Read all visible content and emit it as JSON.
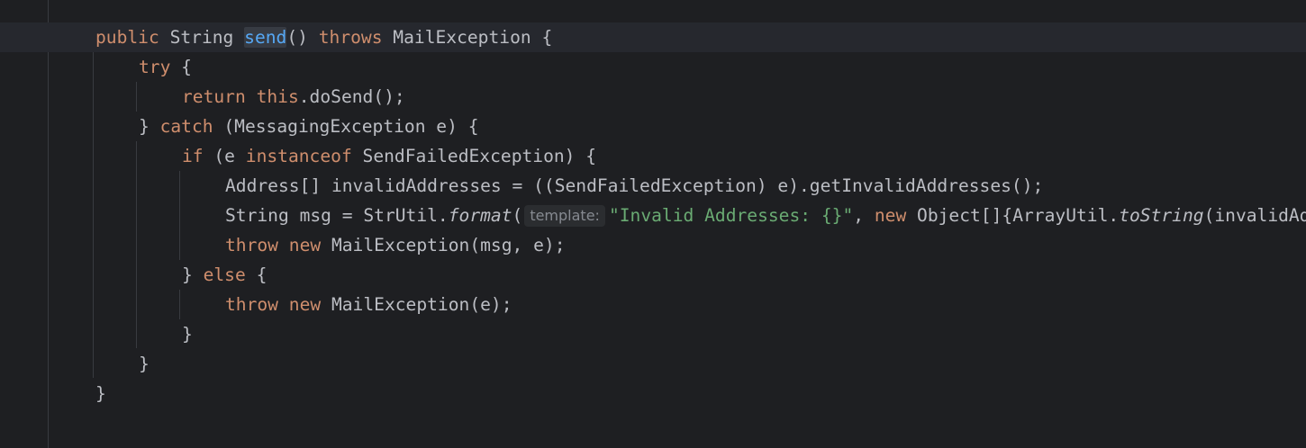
{
  "editor": {
    "lines": [
      {
        "indent": 0,
        "tokens": [
          {
            "t": "public",
            "c": "kw"
          },
          {
            "t": " String ",
            "c": ""
          },
          {
            "t": "send",
            "c": "fn hl-ident"
          },
          {
            "t": "() ",
            "c": ""
          },
          {
            "t": "throws",
            "c": "kw"
          },
          {
            "t": " MailException {",
            "c": ""
          }
        ]
      },
      {
        "indent": 1,
        "tokens": [
          {
            "t": "try",
            "c": "kw"
          },
          {
            "t": " {",
            "c": ""
          }
        ]
      },
      {
        "indent": 2,
        "tokens": [
          {
            "t": "return",
            "c": "kw"
          },
          {
            "t": " ",
            "c": ""
          },
          {
            "t": "this",
            "c": "kw"
          },
          {
            "t": ".doSend();",
            "c": ""
          }
        ]
      },
      {
        "indent": 1,
        "tokens": [
          {
            "t": "} ",
            "c": ""
          },
          {
            "t": "catch",
            "c": "kw"
          },
          {
            "t": " (MessagingException e) {",
            "c": ""
          }
        ]
      },
      {
        "indent": 2,
        "tokens": [
          {
            "t": "if",
            "c": "kw"
          },
          {
            "t": " (e ",
            "c": ""
          },
          {
            "t": "instanceof",
            "c": "kw"
          },
          {
            "t": " SendFailedException) {",
            "c": ""
          }
        ]
      },
      {
        "indent": 3,
        "tokens": [
          {
            "t": "Address[] invalidAddresses = ((SendFailedException) e).getInvalidAddresses();",
            "c": ""
          }
        ]
      },
      {
        "indent": 3,
        "tokens": [
          {
            "t": "String msg = StrUtil.",
            "c": ""
          },
          {
            "t": "format",
            "c": "it"
          },
          {
            "t": "(",
            "c": ""
          },
          {
            "t": "template:",
            "c": "hint"
          },
          {
            "t": "\"Invalid Addresses: {}\"",
            "c": "str"
          },
          {
            "t": ", ",
            "c": ""
          },
          {
            "t": "new",
            "c": "kw"
          },
          {
            "t": " Object[]{ArrayUtil.",
            "c": ""
          },
          {
            "t": "toString",
            "c": "it"
          },
          {
            "t": "(invalidAddresses)});",
            "c": ""
          }
        ]
      },
      {
        "indent": 3,
        "tokens": [
          {
            "t": "throw",
            "c": "kw"
          },
          {
            "t": " ",
            "c": ""
          },
          {
            "t": "new",
            "c": "kw"
          },
          {
            "t": " MailException(msg, e);",
            "c": ""
          }
        ]
      },
      {
        "indent": 2,
        "tokens": [
          {
            "t": "} ",
            "c": ""
          },
          {
            "t": "else",
            "c": "kw"
          },
          {
            "t": " {",
            "c": ""
          }
        ]
      },
      {
        "indent": 3,
        "tokens": [
          {
            "t": "throw",
            "c": "kw"
          },
          {
            "t": " ",
            "c": ""
          },
          {
            "t": "new",
            "c": "kw"
          },
          {
            "t": " MailException(e);",
            "c": ""
          }
        ]
      },
      {
        "indent": 2,
        "tokens": [
          {
            "t": "}",
            "c": ""
          }
        ]
      },
      {
        "indent": 1,
        "tokens": [
          {
            "t": "}",
            "c": ""
          }
        ]
      },
      {
        "indent": 0,
        "tokens": [
          {
            "t": "}",
            "c": ""
          }
        ]
      }
    ],
    "colors": {
      "background": "#1e1f22",
      "keyword": "#cf8e6d",
      "function": "#56a8f5",
      "string": "#6aab73",
      "text": "#bcbec4",
      "hint": "#868a91"
    }
  }
}
